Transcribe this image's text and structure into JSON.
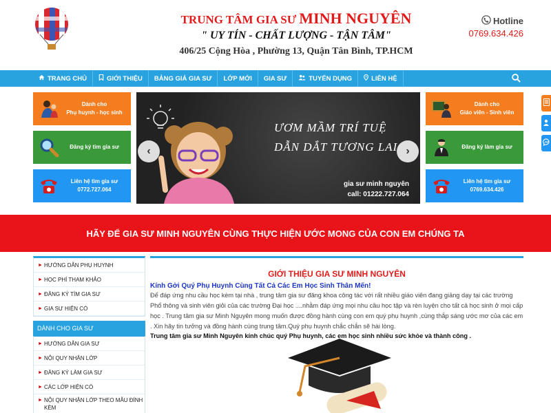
{
  "header": {
    "title_prefix": "TRUNG TÂM GIA SƯ",
    "title_name": "MINH NGUYÊN",
    "slogan": "\" UY TÍN -  CHẤT LƯỢNG - TẬN TÂM\"",
    "address": "406/25 Cộng Hòa , Phường 13, Quận Tân Bình, TP.HCM",
    "hotline_label": "Hotline",
    "hotline_number": "0769.634.426"
  },
  "nav": {
    "items": [
      {
        "label": "TRANG CHỦ",
        "icon": "home-icon"
      },
      {
        "label": "GIỚI THIỆU",
        "icon": "bookmark-icon"
      },
      {
        "label": "BẢNG GIÁ GIA SƯ",
        "icon": ""
      },
      {
        "label": "LỚP MỚI",
        "icon": ""
      },
      {
        "label": "GIA SƯ",
        "icon": ""
      },
      {
        "label": "TUYỂN DỤNG",
        "icon": "users-icon"
      },
      {
        "label": "LIÊN HỆ",
        "icon": "map-marker-icon"
      }
    ]
  },
  "tiles": {
    "parents": {
      "line1": "Dành cho",
      "line2": "Phụ huynh - học sinh"
    },
    "find_tutor": {
      "line1": "Đăng ký tìm gia sư"
    },
    "contact_find": {
      "line1": "Liên hệ tìm gia sư",
      "line2": "0772.727.064"
    },
    "teachers": {
      "line1": "Dành cho",
      "line2": "Giáo viên - Sinh viên"
    },
    "become_tutor": {
      "line1": "Đăng ký làm gia sư"
    },
    "contact_tutor": {
      "line1": "Liên hệ tìm gia sư",
      "line2": "0769.634.426"
    }
  },
  "slider": {
    "headline1": "ƯƠM MẦM TRÍ TUỆ",
    "headline2": "DẪN DẮT TƯƠNG LAI",
    "caption1": "gia sư minh nguyên",
    "caption2": "call: 01222.727.064",
    "prev": "‹",
    "next": "›"
  },
  "banner": "HÃY ĐỂ GIA SƯ MINH NGUYÊN CÙNG THỰC HIỆN ƯỚC MONG CỦA CON EM CHÚNG TA",
  "sidebar": {
    "parent_items": [
      "HƯỚNG DẪN PHỤ HUYNH",
      "HỌC PHÍ THAM KHẢO",
      "ĐĂNG KÝ TÌM GIA SƯ",
      "GIA SƯ HIỆN CÓ"
    ],
    "tutor_heading": "DÀNH CHO GIA SƯ",
    "tutor_items": [
      "HƯỚNG DẪN GIA SƯ",
      "NỘI QUY NHẬN LỚP",
      "ĐĂNG KÝ LÀM GIA SƯ",
      "CÁC LỚP HIỆN CÓ",
      "NỘI QUY NHẬN LỚP THEO MẪU ĐÍNH KÈM"
    ]
  },
  "main": {
    "title": "GIỚI THIỆU GIA SƯ MINH NGUYÊN",
    "greeting": "Kính Gởi Quý Phụ Huynh Cùng Tất Cả Các Em Học Sinh Thân Mến!",
    "paragraph": "Để đáp ứng nhu cầu học kèm tại nhà , trung tâm gia sư đăng khoa công tác với rất nhiều giáo viên đang giảng dạy tại các trường Phổ thông và sinh viên giỏi của các trường Đại học ....nhằm đáp ứng mọi nhu cầu học tập và rèn luyện cho tất cả học sinh ở mọi cấp học . Trung tâm gia sư Minh Nguyên mong muốn được đồng hành cùng con em quý phụ huynh ,cùng thắp sáng ước mơ của các em . Xin hãy tin tưởng và đồng hành cùng trung tâm.Quý phụ huynh chắc chắn sẽ hài lòng.",
    "closing": "Trung tâm gia sư Minh Nguyên kính chúc quý Phụ huynh, các em học sinh nhiều sức khỏe  và thành công ."
  },
  "colors": {
    "brand_red": "#e21a1a",
    "nav_blue": "#29a3df",
    "orange": "#f47d20",
    "green": "#3a9a3a",
    "blue": "#2196f3"
  }
}
